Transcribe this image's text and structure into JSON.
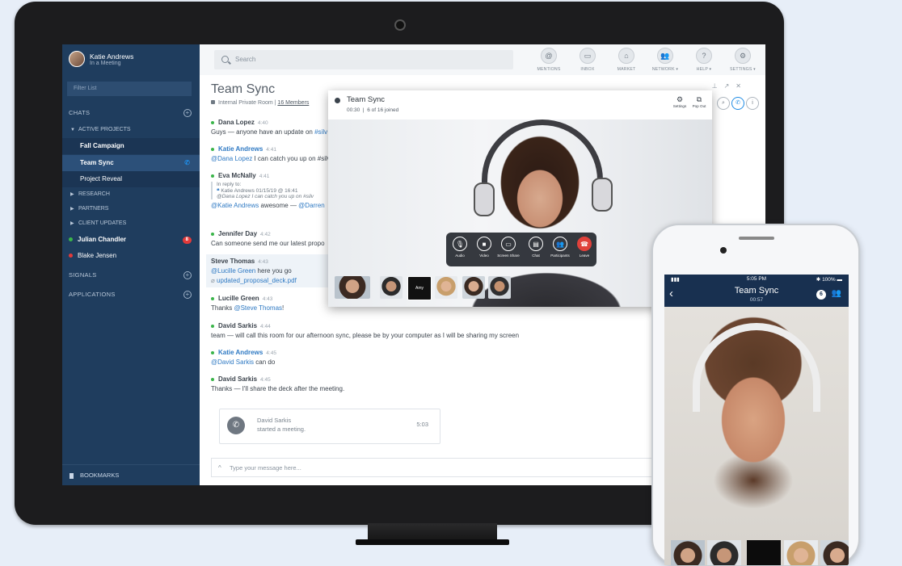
{
  "sidebar": {
    "user_name": "Katie Andrews",
    "user_status": "In a Meeting",
    "filter_placeholder": "Filter List",
    "chats_label": "CHATS",
    "groups": [
      {
        "label": "ACTIVE PROJECTS",
        "expanded": true
      },
      {
        "label": "RESEARCH",
        "expanded": false
      },
      {
        "label": "PARTNERS",
        "expanded": false
      },
      {
        "label": "CLIENT UPDATES",
        "expanded": false
      }
    ],
    "rooms": [
      "Fall Campaign",
      "Team Sync",
      "Project Reveal"
    ],
    "people": [
      {
        "name": "Julian Chandler",
        "badge": "8",
        "status_color": "#3bb54a"
      },
      {
        "name": "Blake Jensen",
        "status_color": "#e23a3a"
      }
    ],
    "signals_label": "SIGNALS",
    "applications_label": "APPLICATIONS",
    "bookmarks_label": "BOOKMARKS",
    "accent_color": "#1f8be4"
  },
  "topbar": {
    "search_placeholder": "Search",
    "nav": [
      "MENTIONS",
      "INBOX",
      "MARKET",
      "NETWORK ▾",
      "HELP ▾",
      "SETTINGS ▾"
    ]
  },
  "room": {
    "title": "Team Sync",
    "meta": "Internal Private Room",
    "members": "16 Members"
  },
  "messages": [
    {
      "name": "Dana Lopez",
      "time": "4:40",
      "pre": "Guys — anyone have an update on ",
      "mention": "#silv",
      "post": ""
    },
    {
      "name": "Katie Andrews",
      "time": "4:41",
      "pre": "",
      "mention": "@Dana Lopez",
      "post": " I can catch you up on #silv"
    },
    {
      "name": "Eva McNally",
      "time": "4:41",
      "reply_label": "In reply to:",
      "reply_meta": "Katie Andrews 01/15/19 @ 16:41",
      "reply_text": "@Dana Lopez I can catch you up on #silv",
      "pre": "",
      "mention": "@Katie Andrews",
      "post": " awesome — ",
      "mention2": "@Darren"
    },
    {
      "name": "Jennifer Day",
      "time": "4:42",
      "pre": "Can someone send me our latest propo",
      "mention": "",
      "post": ""
    },
    {
      "name": "Steve Thomas",
      "time": "4:43",
      "pre": "",
      "mention": "@Lucille Green",
      "post": " here you go",
      "attachment": "updated_proposal_deck.pdf"
    },
    {
      "name": "Lucille Green",
      "time": "4:43",
      "pre": "Thanks ",
      "mention": "@Steve Thomas",
      "post": "!"
    },
    {
      "name": "David Sarkis",
      "time": "4:44",
      "pre": "team — will call this room for our afternoon sync, please be by your computer as I will be sharing my screen",
      "mention": "",
      "post": ""
    },
    {
      "name": "Katie Andrews",
      "time": "4:45",
      "pre": "",
      "mention": "@David Sarkis",
      "post": " can do"
    },
    {
      "name": "David Sarkis",
      "time": "4:45",
      "pre": "Thanks — I'll share the deck after the meeting.",
      "mention": "",
      "post": ""
    }
  ],
  "meeting_card": {
    "name": "David Sarkis",
    "action": "started a meeting.",
    "duration": "5:03"
  },
  "composer": {
    "placeholder": "Type your message here..."
  },
  "video_call": {
    "title": "Team Sync",
    "elapsed": "00:30",
    "joined": "6 of 16 joined",
    "settings_label": "Settings",
    "popout_label": "Pop Out",
    "controls": [
      "Audio",
      "Video",
      "Screen Share",
      "Chat",
      "Participants",
      "Leave"
    ],
    "anon_tile": "Amy",
    "leave_color": "#e0413b"
  },
  "phone": {
    "time": "5:05 PM",
    "battery": "100%",
    "title": "Team Sync",
    "elapsed": "00:57",
    "participant_count": "6"
  }
}
